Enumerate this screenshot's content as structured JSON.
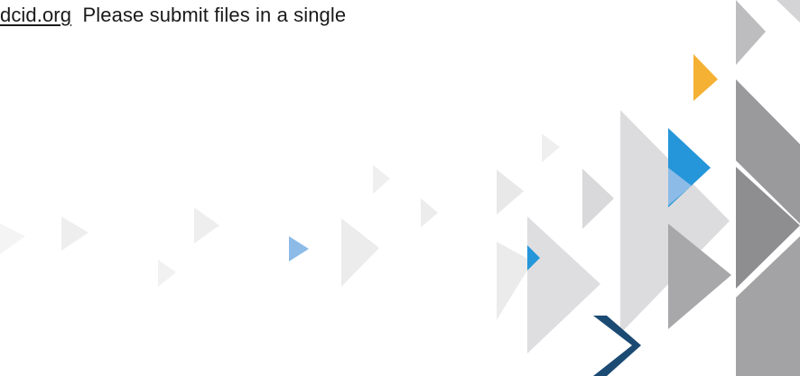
{
  "body_text": {
    "link_fragment": "dcid.org",
    "sentence": "Please submit files in a single"
  },
  "colors": {
    "text": "#1a1a1a",
    "light_gray": "#ebebeb",
    "mid_gray": "#d4d4d6",
    "gray": "#bfbfc1",
    "dark_gray": "#909092",
    "orange": "#f5b133",
    "blue": "#2596d9",
    "light_blue": "#8cbbe8",
    "navy": "#1b4a73"
  }
}
